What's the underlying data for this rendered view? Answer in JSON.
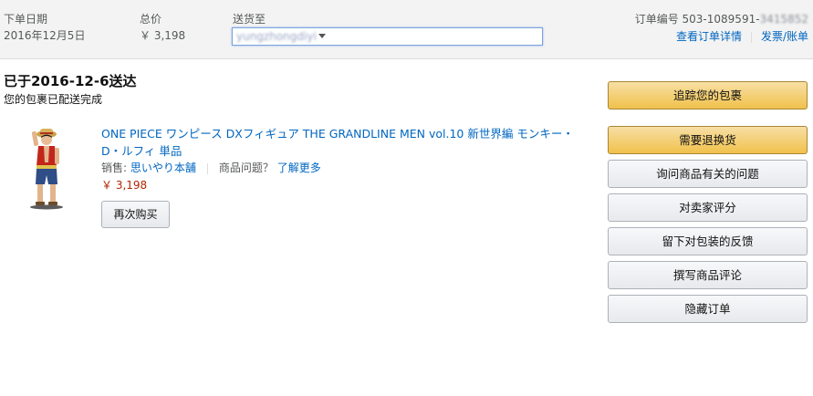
{
  "header": {
    "order_date_label": "下单日期",
    "order_date_value": "2016年12月5日",
    "total_label": "总价",
    "total_value": "￥ 3,198",
    "ship_to_label": "送货至",
    "ship_to_value": "yungzhongdiyi",
    "order_number_label": "订单编号",
    "order_number_value": "503-1089591-",
    "order_number_hidden": "3415852",
    "view_details_link": "查看订单详情",
    "invoice_link": "发票/账单"
  },
  "shipment": {
    "status_title": "已于2016-12-6送达",
    "status_sub": "您的包裹已配送完成"
  },
  "product": {
    "title": "ONE PIECE ワンピース DXフィギュア THE GRANDLINE MEN vol.10 新世界編 モンキー・D・ルフィ 単品",
    "seller_label": "销售:",
    "seller_name": "思いやり本舗",
    "question_label": "商品问题？",
    "learn_more": "了解更多",
    "price": "￥ 3,198",
    "buy_again_label": "再次购买",
    "image_icon": "luffy-figure-image"
  },
  "actions": {
    "track": "追踪您的包裹",
    "return": "需要退换货",
    "ask": "询问商品有关的问题",
    "seller_feedback": "对卖家评分",
    "package_feedback": "留下对包装的反馈",
    "review": "撰写商品评论",
    "hide": "隐藏订单"
  },
  "colors": {
    "link": "#0066c0",
    "price": "#b12704",
    "primary_button": "#f0c14b",
    "header_bg": "#f3f3f3"
  }
}
